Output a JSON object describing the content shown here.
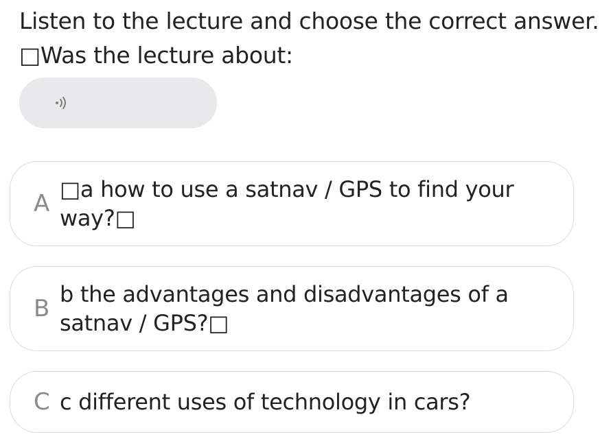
{
  "instruction": "Listen to the lecture and choose the correct answer.",
  "question": "□Was the lecture about:",
  "audio": {
    "icon": "speaker-icon",
    "color": "#e9e8ea"
  },
  "options": [
    {
      "letter": "A",
      "text": "□a how to use a satnav / GPS to find your way?□"
    },
    {
      "letter": "B",
      "text": "b the advantages and disadvantages of a satnav / GPS?□"
    },
    {
      "letter": "C",
      "text": "c different uses of technology in cars?"
    }
  ],
  "colors": {
    "text": "#222222",
    "letter": "#8a8a8a",
    "border": "#dcdcdc"
  }
}
